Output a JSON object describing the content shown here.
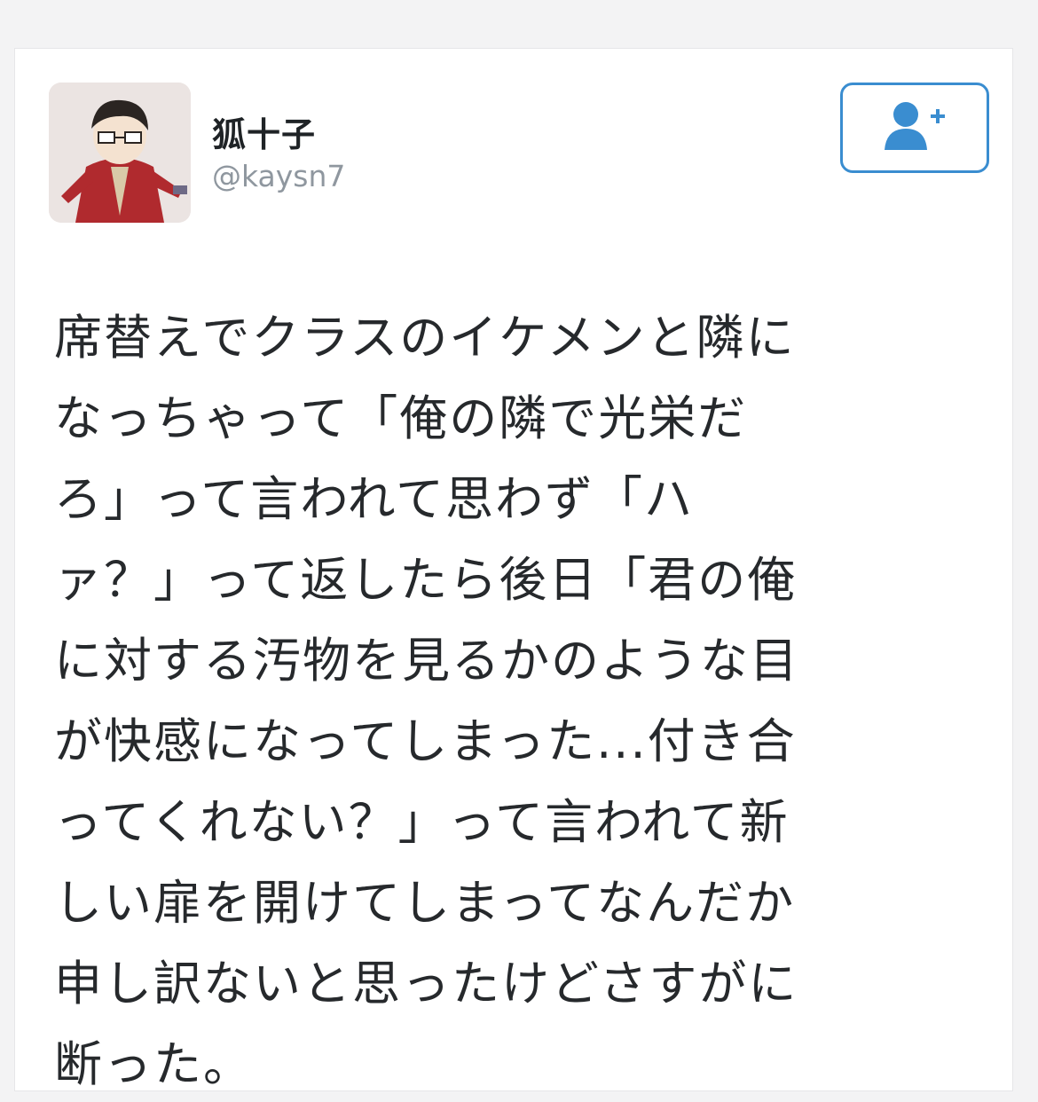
{
  "tweet": {
    "author": {
      "display_name": "狐十子",
      "handle": "@kaysn7"
    },
    "follow_button_icon": "add-user-icon",
    "text_lines": [
      "席替えでクラスのイケメンと隣に",
      "なっちゃって「俺の隣で光栄だ",
      "ろ」って言われて思わず「ハ",
      "ァ？」って返したら後日「君の俺",
      "に対する汚物を見るかのような目",
      "が快感になってしまった...付き合",
      "ってくれない？」って言われて新",
      "しい扉を開けてしまってなんだか",
      "申し訳ないと思ったけどさすがに",
      "断った。"
    ]
  },
  "colors": {
    "accent": "#3a8dd0",
    "text": "#26292c",
    "handle": "#8f979f"
  }
}
